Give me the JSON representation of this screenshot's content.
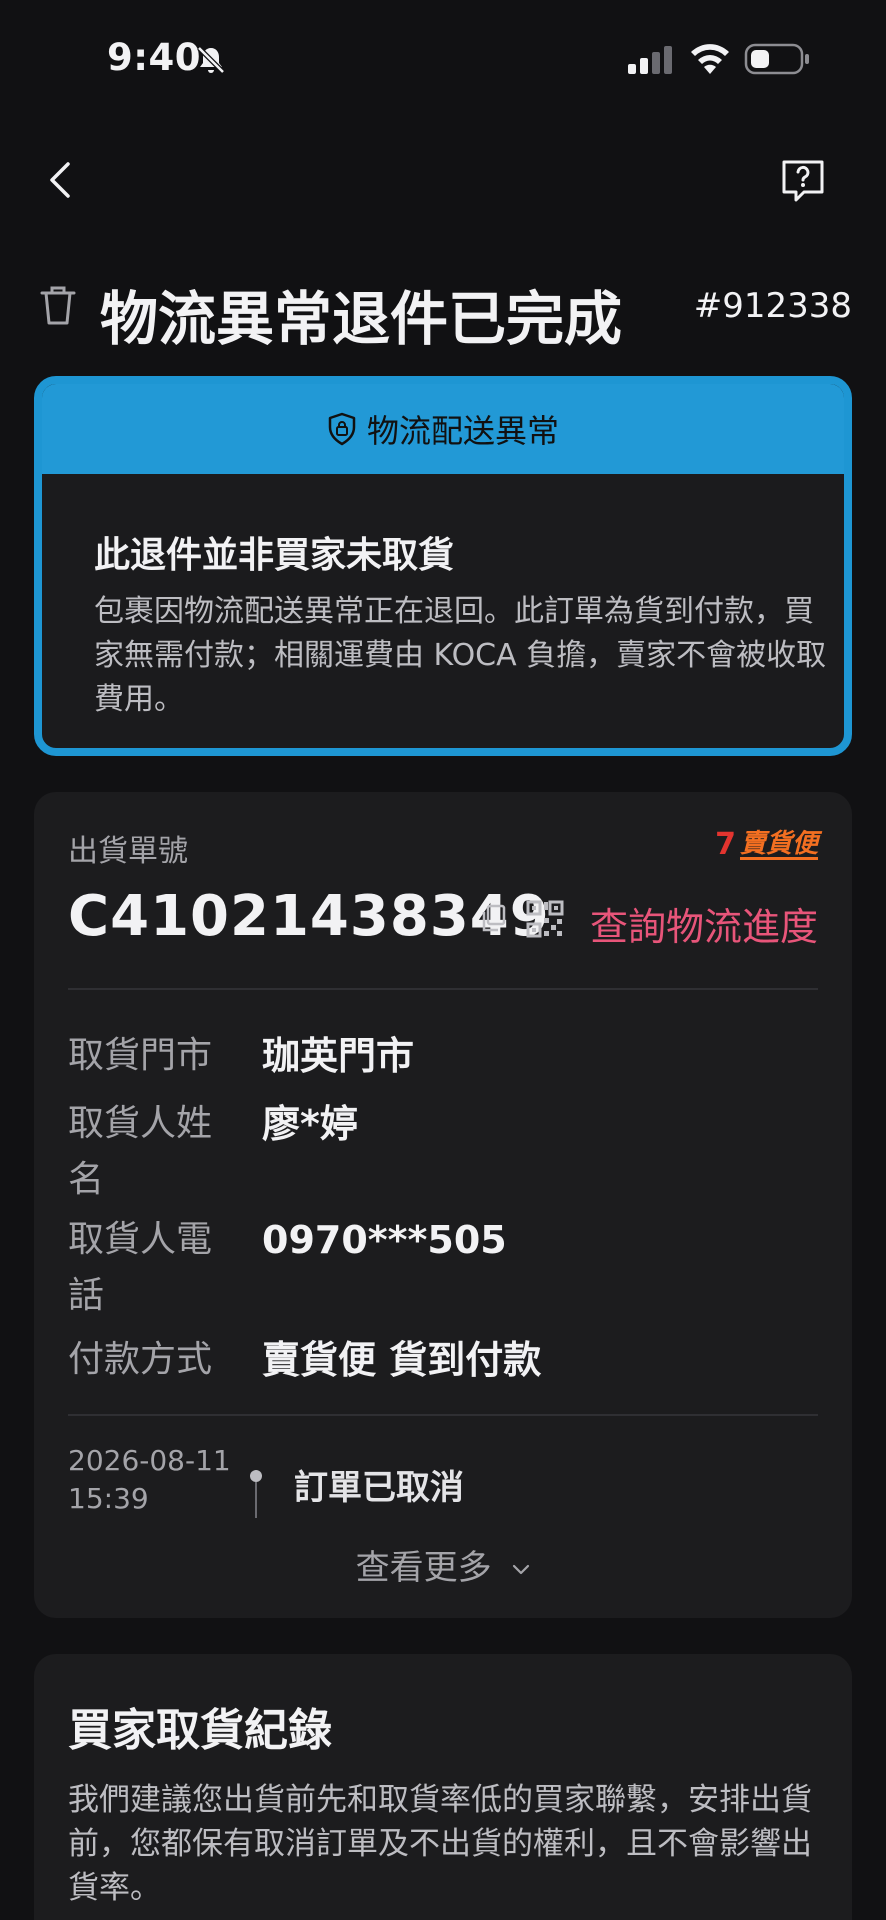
{
  "status_bar": {
    "time": "9:40"
  },
  "header": {
    "title": "物流異常退件已完成",
    "order_number": "#912338"
  },
  "alert": {
    "banner": "物流配送異常",
    "heading": "此退件並非買家未取貨",
    "body": "包裹因物流配送異常正在退回。此訂單為貨到付款，買家無需付款；相關運費由 KOCA 負擔，賣家不會被收取費用。"
  },
  "shipment": {
    "label": "出貨單號",
    "carrier_logo": "賣貨便",
    "tracking_number": "C41021438349",
    "track_link": "查詢物流進度",
    "rows": [
      {
        "key": "取貨門市",
        "value": "珈英門市"
      },
      {
        "key": "取貨人姓名",
        "value": "廖*婷"
      },
      {
        "key": "取貨人電話",
        "value": "0970***505"
      },
      {
        "key": "付款方式",
        "value": "賣貨便 貨到付款"
      }
    ],
    "timeline": {
      "date": "2026-08-11",
      "time": "15:39",
      "status": "訂單已取消"
    },
    "see_more": "查看更多"
  },
  "record": {
    "title": "買家取貨紀錄",
    "body": "我們建議您出貨前先和取貨率低的買家聯繫，安排出貨前，您都保有取消訂單及不出貨的權利，且不會影響出貨率。"
  },
  "colors": {
    "accent_blue": "#2299d6",
    "link_pink": "#e8557a",
    "background": "#111113",
    "card": "#1c1c1e"
  }
}
